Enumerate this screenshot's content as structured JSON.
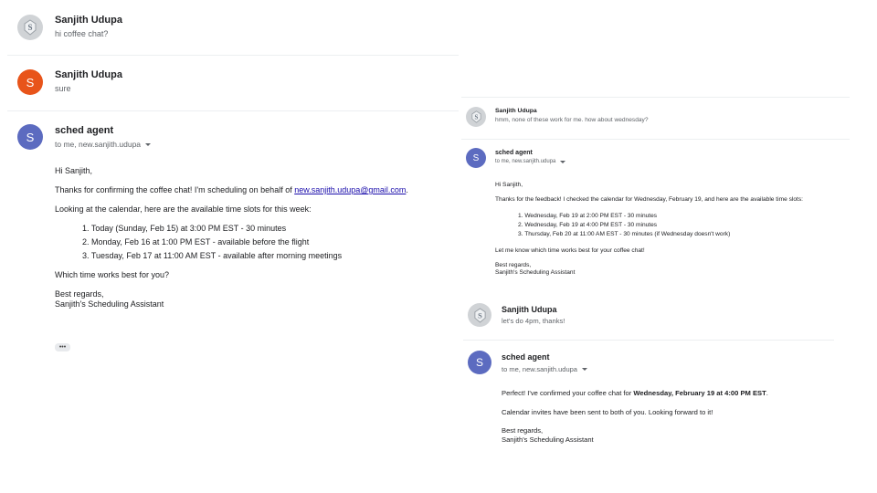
{
  "left": {
    "messages": [
      {
        "sender": "Sanjith Udupa",
        "snippet": "hi coffee chat?",
        "avatar": "logo"
      },
      {
        "sender": "Sanjith Udupa",
        "snippet": "sure",
        "avatar_letter": "S"
      },
      {
        "sender": "sched agent",
        "avatar_letter": "S",
        "recipients": "to me, new.sanjith.udupa"
      }
    ],
    "email": {
      "greeting": "Hi Sanjith,",
      "confirm_prefix": "Thanks for confirming the coffee chat! I'm scheduling on behalf of ",
      "confirm_link": "new.sanjith.udupa@gmail.com",
      "confirm_suffix": ".",
      "intro": "Looking at the calendar, here are the available time slots for this week:",
      "slots": [
        "1. Today (Sunday, Feb 15) at 3:00 PM EST - 30 minutes",
        "2. Monday, Feb 16 at 1:00 PM EST - available before the flight",
        "3. Tuesday, Feb 17 at 11:00 AM EST - available after morning meetings"
      ],
      "question": "Which time works best for you?",
      "signoff": "Best regards,",
      "signature": "Sanjith's Scheduling Assistant",
      "more_label": "•••"
    }
  },
  "right": {
    "messages": [
      {
        "sender": "Sanjith Udupa",
        "snippet": "hmm, none of these work for me. how about wednesday?",
        "avatar": "logo"
      },
      {
        "sender": "sched agent",
        "avatar_letter": "S",
        "recipients": "to me, new.sanjith.udupa"
      },
      {
        "sender": "Sanjith Udupa",
        "snippet": "let's do 4pm, thanks!",
        "avatar": "logo"
      },
      {
        "sender": "sched agent",
        "avatar_letter": "S",
        "recipients": "to me, new.sanjith.udupa"
      }
    ],
    "email1": {
      "greeting": "Hi Sanjith,",
      "feedback": "Thanks for the feedback! I checked the calendar for Wednesday, February 19, and here are the available time slots:",
      "slots": [
        "1. Wednesday, Feb 19 at 2:00 PM EST - 30 minutes",
        "2. Wednesday, Feb 19 at 4:00 PM EST - 30 minutes",
        "3. Thursday, Feb 20 at 11:00 AM EST - 30 minutes (if Wednesday doesn't work)"
      ],
      "question": "Let me know which time works best for your coffee chat!",
      "signoff": "Best regards,",
      "signature": "Sanjith's Scheduling Assistant"
    },
    "email2": {
      "confirm_prefix": "Perfect! I've confirmed your coffee chat for ",
      "confirm_bold": "Wednesday, February 19 at 4:00 PM EST",
      "confirm_suffix": ".",
      "invites": "Calendar invites have been sent to both of you. Looking forward to it!",
      "signoff": "Best regards,",
      "signature": "Sanjith's Scheduling Assistant"
    }
  },
  "colors": {
    "orange_avatar": "#e8541a",
    "blue_avatar": "#5c6bc0",
    "logo_avatar": "#d0d3d6",
    "link": "#1a0dab"
  }
}
